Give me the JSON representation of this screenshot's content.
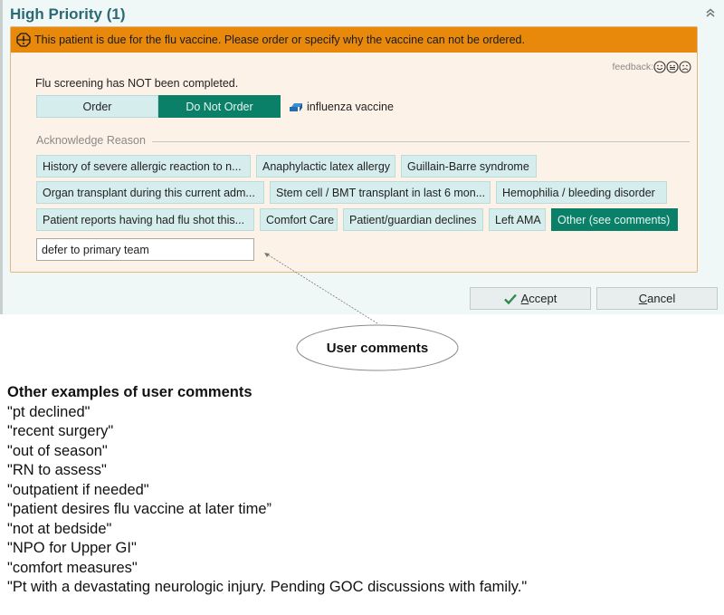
{
  "panel": {
    "title": "High Priority (1)",
    "collapse_icon": "double-chevron-up-icon"
  },
  "alert": {
    "icon": "warning-octagon-icon",
    "message": "This patient is due for the flu vaccine. Please order or specify why the vaccine can not be ordered.",
    "header_color": "#e8890c",
    "feedback": {
      "label": "feedback:",
      "faces": [
        "happy-face-icon",
        "neutral-face-icon",
        "sad-face-icon"
      ]
    },
    "screening_status": "Flu screening has NOT been completed.",
    "order_options": [
      {
        "label": "Order",
        "selected": false
      },
      {
        "label": "Do Not Order",
        "selected": true
      }
    ],
    "medication": {
      "icon": "order-link-icon",
      "label": "influenza vaccine"
    },
    "acknowledge_label": "Acknowledge Reason",
    "reasons": [
      [
        {
          "label": "History of severe allergic reaction to n...",
          "selected": false
        },
        {
          "label": "Anaphylactic latex allergy",
          "selected": false
        },
        {
          "label": "Guillain-Barre syndrome",
          "selected": false
        }
      ],
      [
        {
          "label": "Organ transplant during this current adm...",
          "selected": false
        },
        {
          "label": "Stem cell / BMT transplant in last 6 mon...",
          "selected": false
        },
        {
          "label": "Hemophilia / bleeding disorder",
          "selected": false
        }
      ],
      [
        {
          "label": "Patient reports having had flu shot this...",
          "selected": false
        },
        {
          "label": "Comfort Care",
          "selected": false
        },
        {
          "label": "Patient/guardian declines",
          "selected": false
        },
        {
          "label": "Left AMA",
          "selected": false
        },
        {
          "label": "Other (see comments)",
          "selected": true
        }
      ]
    ],
    "comment_value": "defer to primary team",
    "selected_color": "#0b8068"
  },
  "footer": {
    "accept_label_ul": "A",
    "accept_label_rest": "ccept",
    "cancel_label_ul": "C",
    "cancel_label_rest": "ancel"
  },
  "annotation": {
    "callout": "User comments"
  },
  "examples": {
    "heading": "Other examples of user comments",
    "items": [
      "\"pt declined\"",
      "\"recent surgery\"",
      "\"out of season\"",
      "\"RN to assess\"",
      "\"outpatient if needed\"",
      "\"patient desires flu vaccine at later time”",
      "\"not at bedside\"",
      "\"NPO for Upper GI\"",
      "\"comfort measures\"",
      "\"Pt with a devastating neurologic injury. Pending GOC discussions with family.\""
    ]
  }
}
